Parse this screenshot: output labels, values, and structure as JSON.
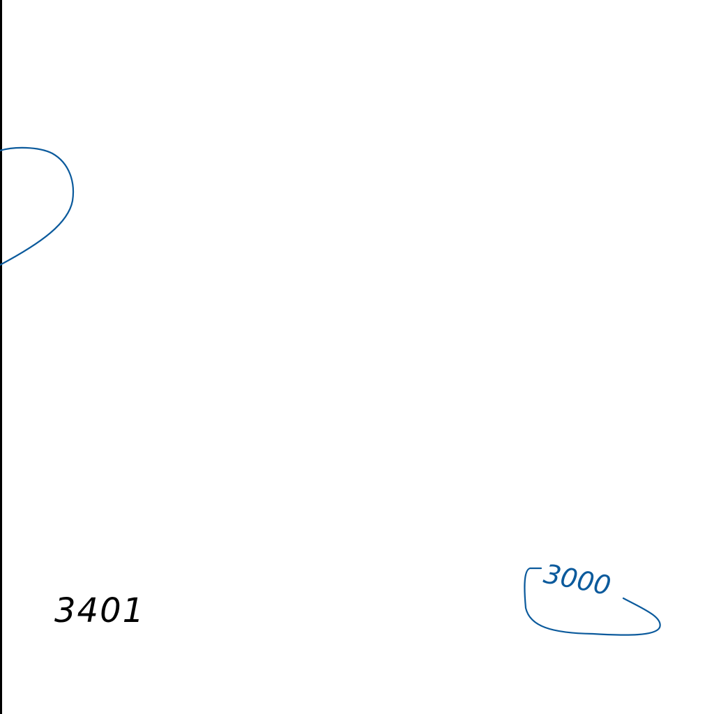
{
  "map": {
    "background_color": "#ffffff",
    "frame_color": "#000000",
    "contour_color": "#0b5a9c",
    "spot_height_color": "#000000",
    "spot_height": "3401",
    "contour_label": "3000"
  }
}
